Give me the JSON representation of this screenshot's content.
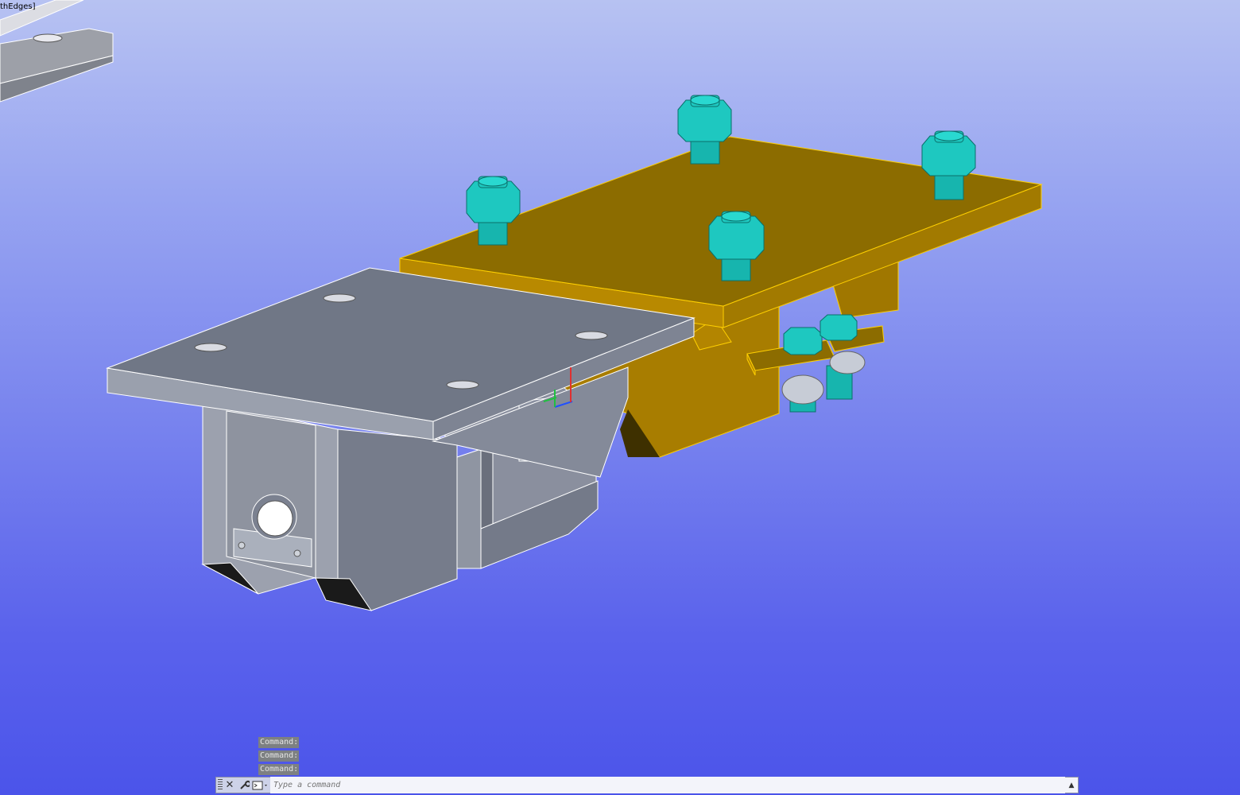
{
  "viewport": {
    "visual_style_label": "thEdges]",
    "background_top": "#b7c2f2",
    "background_bottom": "#4b54ea",
    "colors": {
      "gray_part": "#707786",
      "gold_part": "#8c6c00",
      "gold_edge": "#ffd000",
      "bolt": "#1ec8c0"
    }
  },
  "command_line": {
    "history": [
      "Command:",
      "Command:",
      "Command:"
    ],
    "placeholder": "Type a command",
    "close_glyph": "✕",
    "customize_glyph": "🔧",
    "history_glyph": "▲"
  }
}
